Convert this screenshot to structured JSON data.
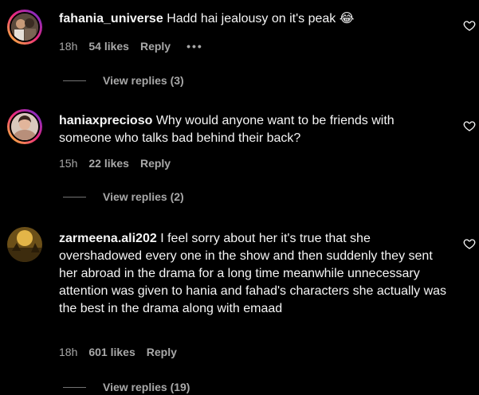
{
  "colors": {
    "background": "#000000",
    "text": "#f5f5f5",
    "secondary": "#a8a8a8",
    "line": "#737373"
  },
  "comments": [
    {
      "username": "fahania_universe",
      "text": "Hadd hai jealousy on it's peak 😂",
      "time": "18h",
      "likes": "54 likes",
      "reply": "Reply",
      "more": "•••",
      "view_replies": "View replies (3)",
      "avatar_icon": "profile-photo"
    },
    {
      "username": "haniaxprecioso",
      "text": "Why would anyone want to be friends with someone who talks bad behind their back?",
      "time": "15h",
      "likes": "22 likes",
      "reply": "Reply",
      "view_replies": "View replies (2)",
      "avatar_icon": "profile-photo"
    },
    {
      "username": "zarmeena.ali202",
      "text": "I feel sorry about her it's true that she overshadowed every one in the show and then suddenly they sent her abroad in the drama for a long time meanwhile unnecessary attention was given to hania and fahad's characters she actually was the best in the drama along with emaad",
      "time": "18h",
      "likes": "601 likes",
      "reply": "Reply",
      "view_replies": "View replies (19)",
      "avatar_icon": "profile-photo"
    }
  ]
}
